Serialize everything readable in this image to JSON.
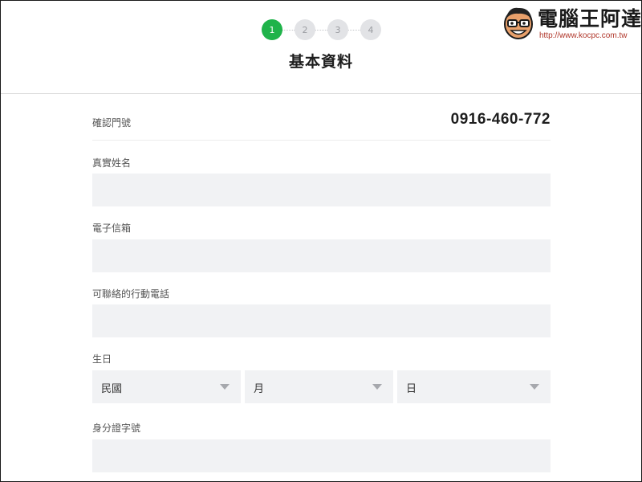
{
  "steps": [
    "1",
    "2",
    "3",
    "4"
  ],
  "active_step": 1,
  "header": {
    "title": "基本資料"
  },
  "watermark": {
    "title": "電腦王阿達",
    "url": "http://www.kocpc.com.tw"
  },
  "form": {
    "confirm_phone_label": "確認門號",
    "confirm_phone_value": "0916-460-772",
    "name_label": "真實姓名",
    "name_value": "",
    "email_label": "電子信箱",
    "email_value": "",
    "mobile_label": "可聯絡的行動電話",
    "mobile_value": "",
    "birthday_label": "生日",
    "birthday_year": "民國",
    "birthday_month": "月",
    "birthday_day": "日",
    "id_label": "身分證字號",
    "id_value": ""
  },
  "colors": {
    "accent": "#1fb34a",
    "field_bg": "#f1f2f4",
    "step_inactive": "#e2e3e6"
  }
}
